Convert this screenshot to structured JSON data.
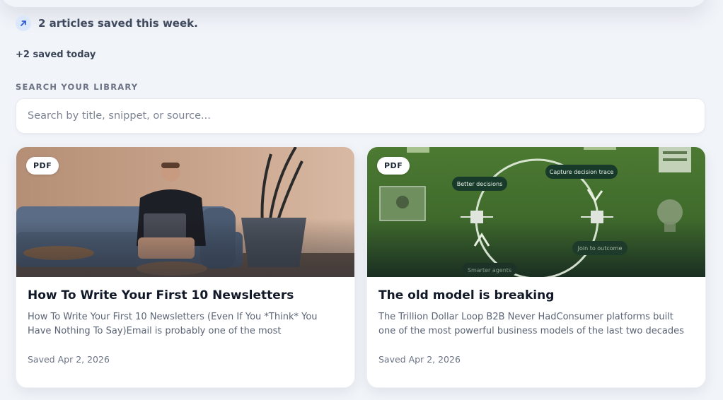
{
  "summary": {
    "text": "2 articles saved this week.",
    "icon": "arrow-up-right-icon",
    "accent": "#2f5bd3"
  },
  "today": "+2 saved today",
  "search": {
    "label": "SEARCH YOUR LIBRARY",
    "placeholder": "Search by title, snippet, or source...",
    "value": ""
  },
  "cards": [
    {
      "badge": "PDF",
      "title": "How To Write Your First 10 Newsletters",
      "snippet": "How To Write Your First 10 Newsletters (Even If You *Think* You Have Nothing To Say)Email is probably one of the most misunderstood...",
      "saved": "Saved Apr 2, 2026"
    },
    {
      "badge": "PDF",
      "title": "The old model is breaking",
      "snippet": "The Trillion Dollar Loop B2B Never HadConsumer platforms built one of the most powerful business models of the last two decades around a...",
      "saved": "Saved Apr 2, 2026",
      "diagram": {
        "nodes": [
          "Better decisions",
          "Capture decision trace",
          "Join to outcome",
          "Smarter agents"
        ]
      }
    }
  ]
}
